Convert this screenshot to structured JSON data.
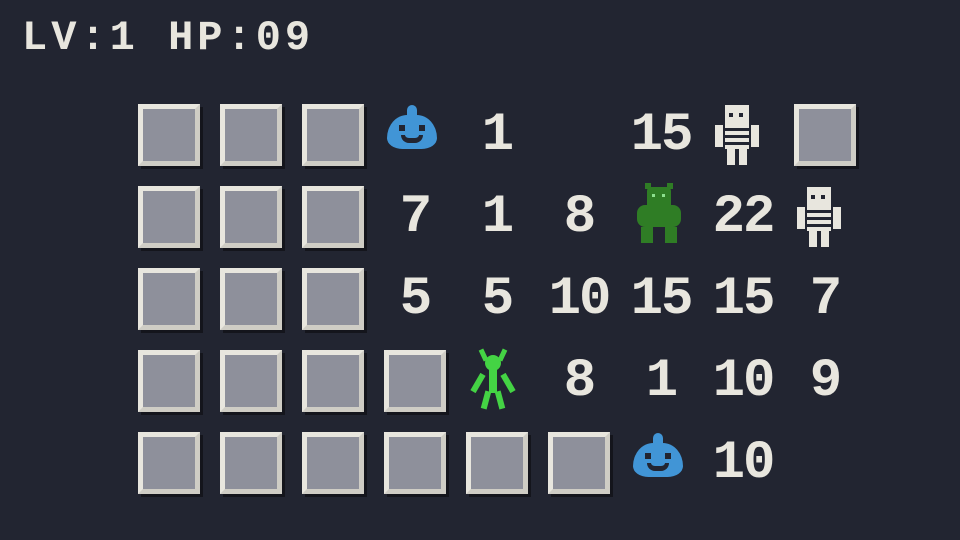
{
  "hud": {
    "level_label": "LV:",
    "level_value": "1",
    "hp_label": "HP:",
    "hp_value": "09"
  },
  "grid": {
    "cols": 9,
    "rows": 5,
    "cells": [
      [
        "tile",
        "tile",
        "tile",
        "slime",
        "1",
        "",
        "15",
        "mummy",
        "tile"
      ],
      [
        "tile",
        "tile",
        "tile",
        "7",
        "1",
        "8",
        "ogre",
        "22",
        "mummy"
      ],
      [
        "tile",
        "tile",
        "tile",
        "5",
        "5",
        "10",
        "15",
        "15",
        "7"
      ],
      [
        "tile",
        "tile",
        "tile",
        "tile",
        "stick",
        "8",
        "1",
        "10",
        "9"
      ],
      [
        "tile",
        "tile",
        "tile",
        "tile",
        "tile",
        "tile",
        "slime",
        "10",
        ""
      ]
    ]
  },
  "sprites": {
    "slime": "slime-blue",
    "mummy": "mummy-white",
    "ogre": "ogre-green",
    "stick": "stick-bug-green"
  },
  "colors": {
    "bg": "#222531",
    "fg": "#e8e6de",
    "tile_fill": "#8e909b",
    "slime": "#4195d6",
    "ogre": "#2f7d25",
    "stick": "#44d344"
  }
}
